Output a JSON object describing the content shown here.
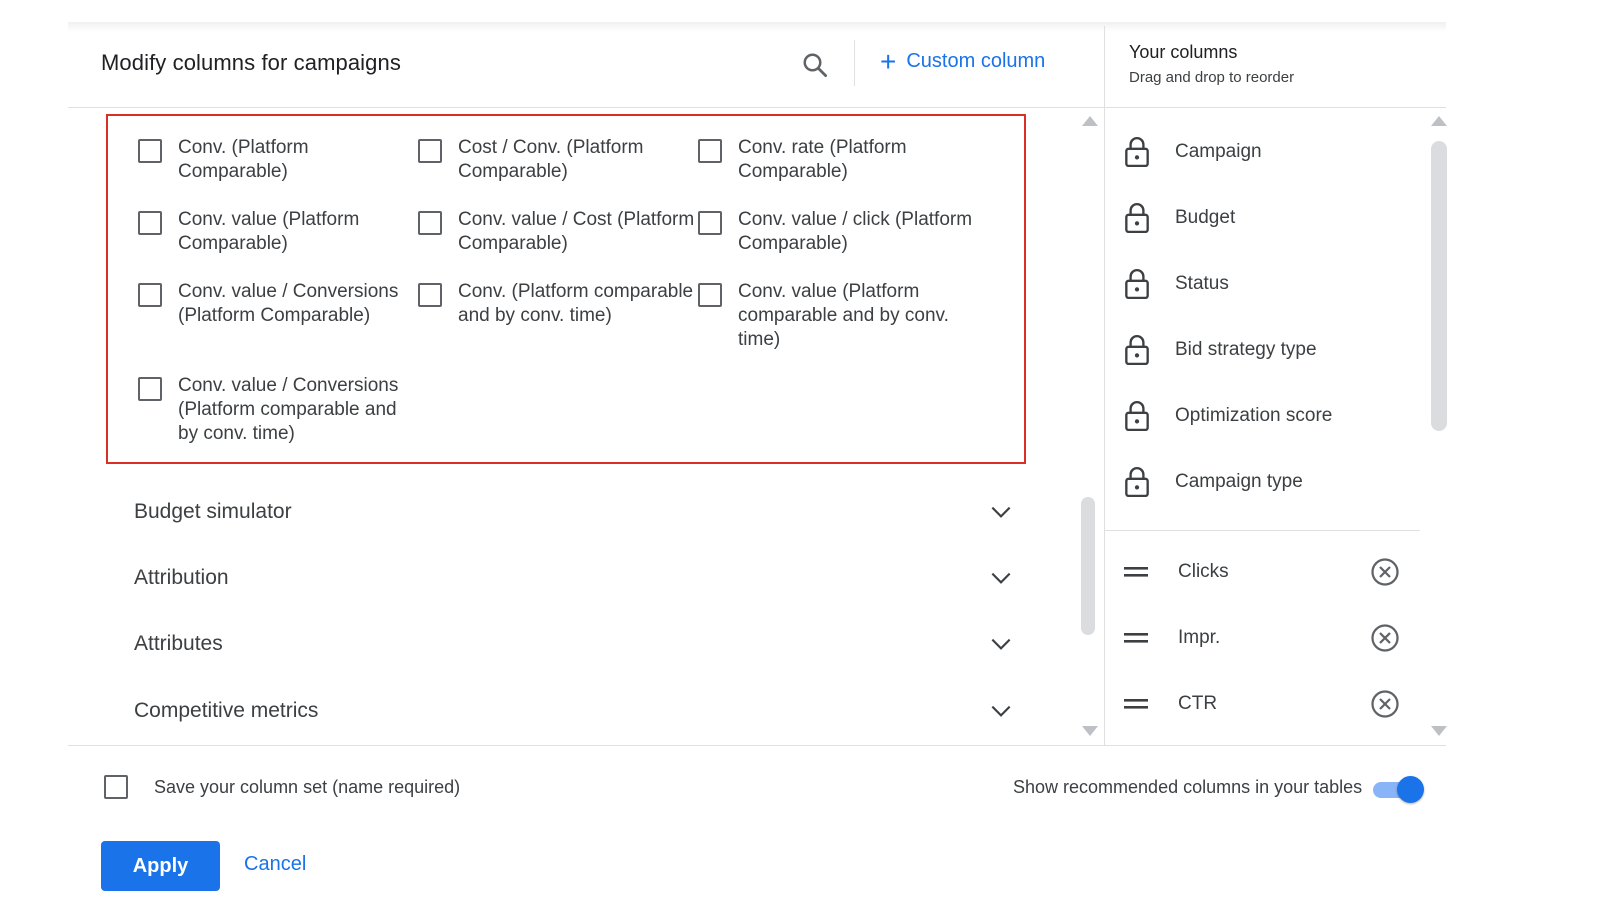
{
  "header": {
    "title": "Modify columns for campaigns",
    "search_icon": "search-icon",
    "custom_column_label": "Custom column"
  },
  "your_columns": {
    "title": "Your columns",
    "subtitle": "Drag and drop to reorder",
    "locked": [
      {
        "label": "Campaign"
      },
      {
        "label": "Budget"
      },
      {
        "label": "Status"
      },
      {
        "label": "Bid strategy type"
      },
      {
        "label": "Optimization score"
      },
      {
        "label": "Campaign type"
      }
    ],
    "movable": [
      {
        "label": "Clicks"
      },
      {
        "label": "Impr."
      },
      {
        "label": "CTR"
      }
    ]
  },
  "metrics": [
    {
      "label": "Conv. (Platform Comparable)",
      "checked": false
    },
    {
      "label": "Cost / Conv. (Platform Comparable)",
      "checked": false
    },
    {
      "label": "Conv. rate (Platform Comparable)",
      "checked": false
    },
    {
      "label": "Conv. value (Platform Comparable)",
      "checked": false
    },
    {
      "label": "Conv. value / Cost (Platform Comparable)",
      "checked": false
    },
    {
      "label": "Conv. value / click (Platform Comparable)",
      "checked": false
    },
    {
      "label": "Conv. value / Conversions (Platform Comparable)",
      "checked": false
    },
    {
      "label": "Conv. (Platform comparable and by conv. time)",
      "checked": false
    },
    {
      "label": "Conv. value (Platform comparable and by conv. time)",
      "checked": false
    },
    {
      "label": "Conv. value / Conversions (Platform comparable and by conv. time)",
      "checked": false
    }
  ],
  "sections": [
    {
      "label": "Budget simulator"
    },
    {
      "label": "Attribution"
    },
    {
      "label": "Attributes"
    },
    {
      "label": "Competitive metrics"
    }
  ],
  "footer": {
    "save_label": "Save your column set (name required)",
    "save_checked": false,
    "recommended_label": "Show recommended columns in your tables",
    "recommended_on": true,
    "apply_label": "Apply",
    "cancel_label": "Cancel"
  },
  "colors": {
    "accent": "#1a73e8",
    "highlight_border": "#d93025",
    "text": "#3c4043"
  }
}
